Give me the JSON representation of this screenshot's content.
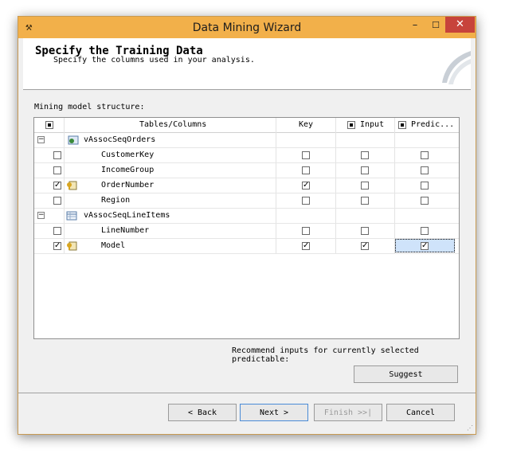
{
  "window": {
    "title": "Data Mining Wizard",
    "min": "–",
    "max": "☐",
    "close": "✕"
  },
  "header": {
    "title": "Specify the Training Data",
    "subtitle": "Specify the columns used in your analysis."
  },
  "structure_label": "Mining model structure:",
  "grid": {
    "columns": [
      "Tables/Columns",
      "Key",
      "Input",
      "Predic..."
    ],
    "rows": [
      {
        "type": "table",
        "name": "vAssocSeqOrders"
      },
      {
        "type": "column",
        "name": "CustomerKey",
        "selected": false,
        "key": false,
        "input": false,
        "predict": false
      },
      {
        "type": "column",
        "name": "IncomeGroup",
        "selected": false,
        "key": false,
        "input": false,
        "predict": false
      },
      {
        "type": "column",
        "name": "OrderNumber",
        "selected": true,
        "key": true,
        "input": false,
        "predict": false
      },
      {
        "type": "column",
        "name": "Region",
        "selected": false,
        "key": false,
        "input": false,
        "predict": false
      },
      {
        "type": "table",
        "name": "vAssocSeqLineItems"
      },
      {
        "type": "column",
        "name": "LineNumber",
        "selected": false,
        "key": false,
        "input": false,
        "predict": false
      },
      {
        "type": "column",
        "name": "Model",
        "selected": true,
        "key": true,
        "input": true,
        "predict": true
      }
    ]
  },
  "recommend_label": "Recommend inputs for currently selected predictable:",
  "buttons": {
    "suggest": "Suggest",
    "back": "< Back",
    "next": "Next >",
    "finish": "Finish >>|",
    "cancel": "Cancel"
  },
  "colors": {
    "titlebar": "#f2b04a",
    "close": "#c7433b",
    "selection": "#cfe3fa"
  }
}
